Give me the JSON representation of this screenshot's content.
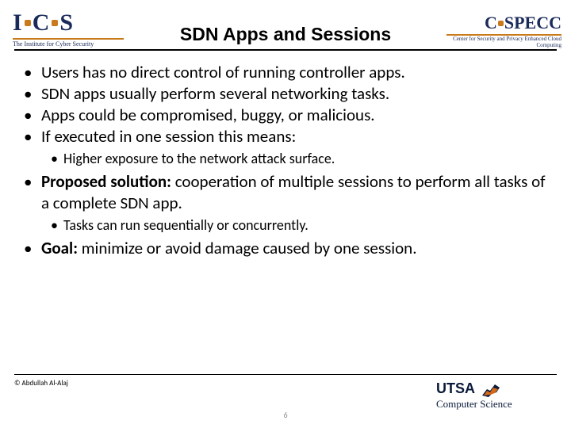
{
  "header": {
    "title": "SDN Apps and Sessions",
    "logo_left": {
      "main": "I·C·S",
      "sub": "The Institute for Cyber Security"
    },
    "logo_right": {
      "main": "C·SPECC",
      "sub": "Center for Security and Privacy Enhanced Cloud Computing"
    }
  },
  "bullets": [
    {
      "text": "Users has no direct control of running controller apps."
    },
    {
      "text": "SDN apps usually perform several networking tasks."
    },
    {
      "text": "Apps could be compromised, buggy, or malicious."
    },
    {
      "text": "If executed in one session this means:",
      "sub": [
        "Higher exposure to the network attack surface."
      ]
    },
    {
      "lead": "Proposed solution:",
      "rest": " cooperation of multiple sessions to perform all tasks of a complete SDN app.",
      "sub": [
        "Tasks can run sequentially or concurrently."
      ]
    },
    {
      "lead": "Goal:",
      "rest": " minimize or avoid damage caused by one session."
    }
  ],
  "footer": {
    "copyright": "© Abdullah Al-Alaj",
    "page": "6",
    "utsa_main": "UTSA",
    "utsa_sub": "Computer Science"
  }
}
